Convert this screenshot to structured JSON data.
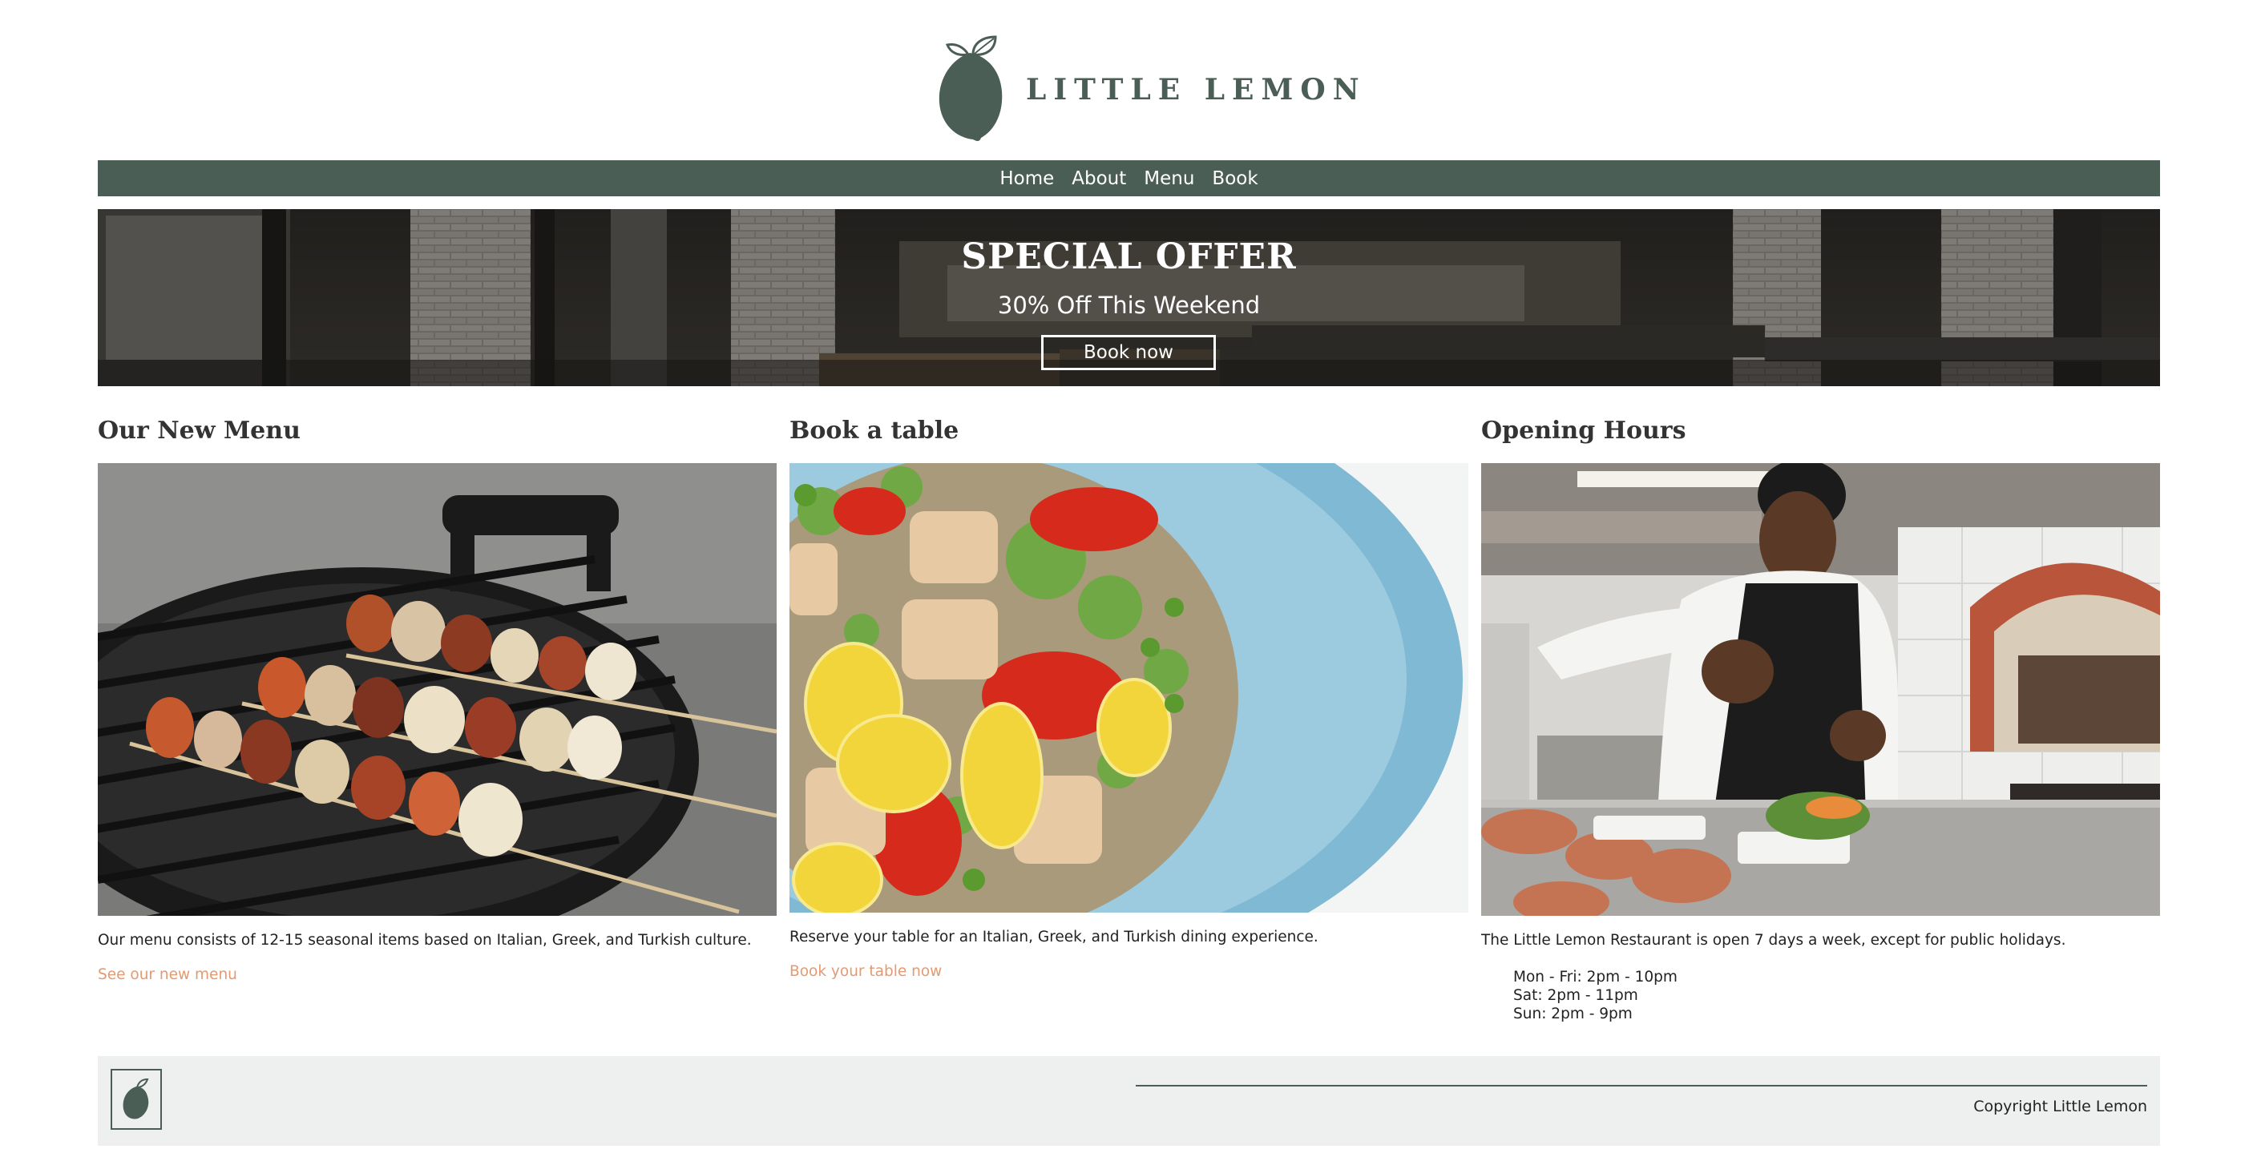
{
  "brand": {
    "name": "LITTLE LEMON",
    "primary_color": "#4a5e55",
    "accent_color": "#e39a72"
  },
  "nav": {
    "items": [
      {
        "label": "Home"
      },
      {
        "label": "About"
      },
      {
        "label": "Menu"
      },
      {
        "label": "Book"
      }
    ]
  },
  "hero": {
    "title": "SPECIAL OFFER",
    "subtitle": "30% Off This Weekend",
    "button_label": "Book now"
  },
  "sections": [
    {
      "title": "Our New Menu",
      "image": "grilled-skewers-photo",
      "text": "Our menu consists of 12-15 seasonal items based on Italian, Greek, and Turkish culture.",
      "link": "See our new menu"
    },
    {
      "title": "Book a table",
      "image": "salad-plate-photo",
      "text": "Reserve your table for an Italian, Greek, and Turkish dining experience.",
      "link": "Book your table now"
    },
    {
      "title": "Opening Hours",
      "image": "chef-kitchen-photo",
      "text": "The Little Lemon Restaurant is open 7 days a week, except for public holidays.",
      "hours": [
        "Mon - Fri: 2pm - 10pm",
        "Sat: 2pm - 11pm",
        "Sun: 2pm - 9pm"
      ]
    }
  ],
  "footer": {
    "copyright": "Copyright Little Lemon"
  }
}
